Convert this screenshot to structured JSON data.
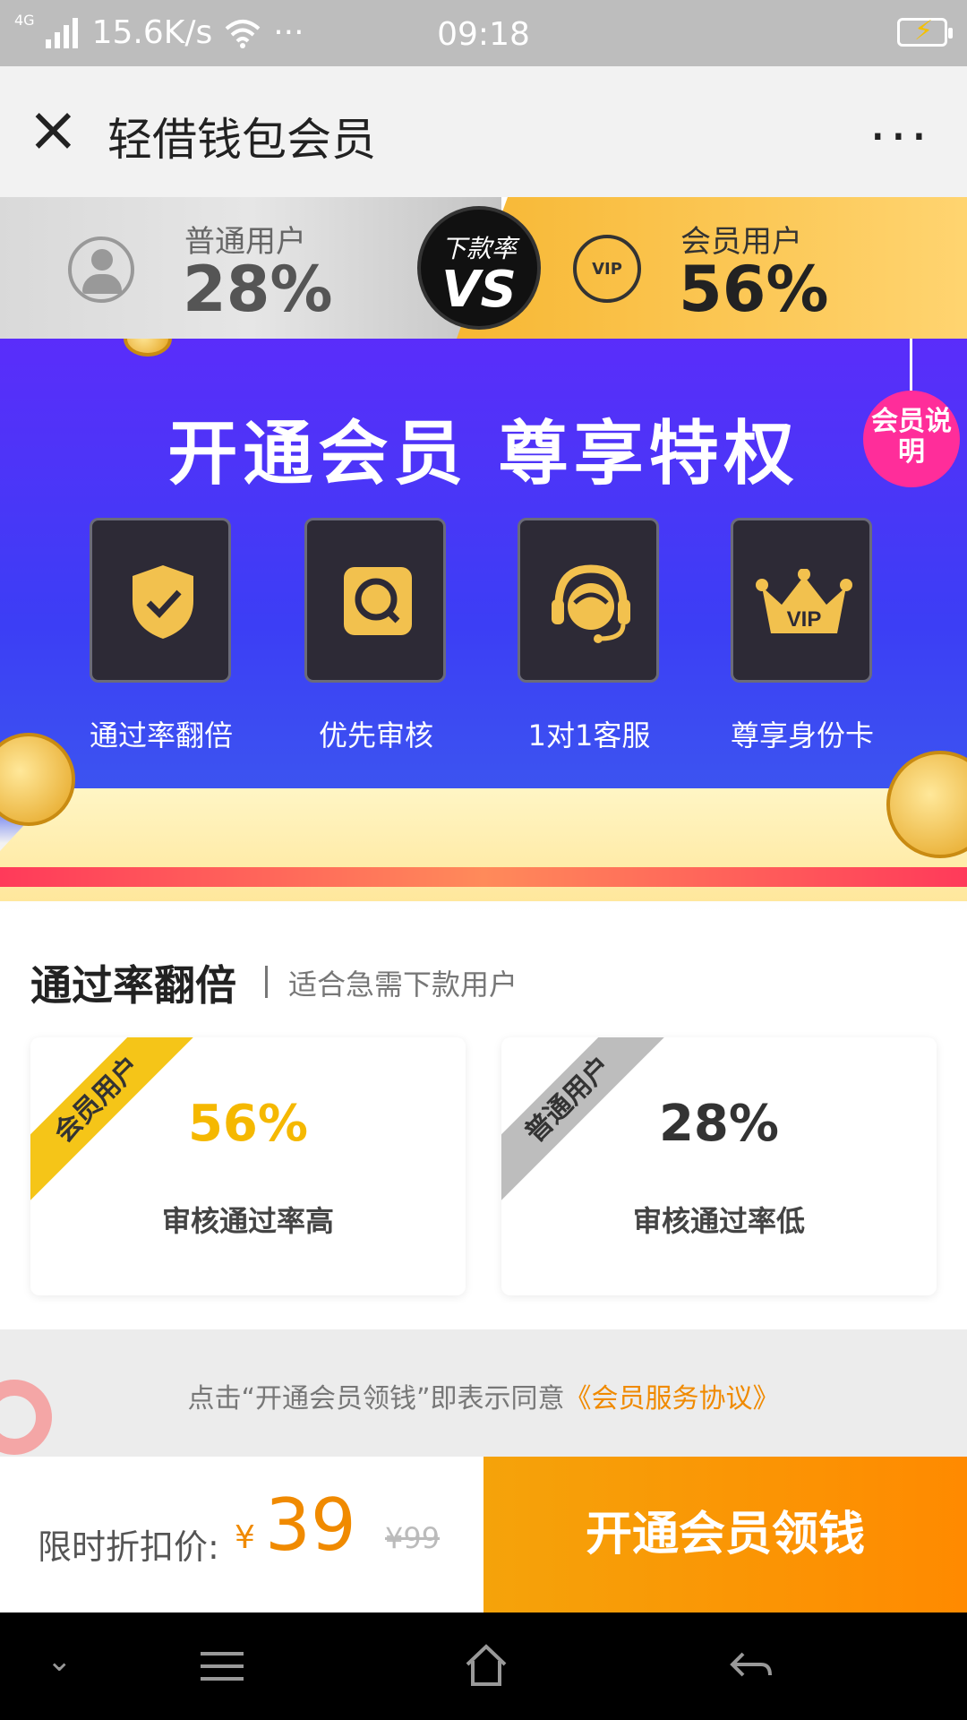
{
  "status_bar": {
    "network": "4G",
    "speed": "15.6K/s",
    "dots": "···",
    "time": "09:18"
  },
  "title_bar": {
    "title": "轻借钱包会员"
  },
  "compare": {
    "normal_label": "普通用户",
    "normal_value": "28%",
    "vs_top": "下款率",
    "vs_text": "VS",
    "vip_badge": "VIP",
    "member_label": "会员用户",
    "member_value": "56%"
  },
  "banner": {
    "headline": "开通会员  尊享特权",
    "explain_button": "会员说明",
    "features": [
      {
        "label": "通过率翻倍",
        "icon": "shield-check-icon"
      },
      {
        "label": "优先审核",
        "icon": "search-icon"
      },
      {
        "label": "1对1客服",
        "icon": "headset-icon"
      },
      {
        "label": "尊享身份卡",
        "icon": "vip-crown-icon"
      }
    ],
    "vip_text": "VIP"
  },
  "section": {
    "title": "通过率翻倍",
    "subtitle": "适合急需下款用户",
    "cards": [
      {
        "ribbon": "会员用户",
        "percent": "56%",
        "desc": "审核通过率高",
        "color": "#f5b800"
      },
      {
        "ribbon": "普通用户",
        "percent": "28%",
        "desc": "审核通过率低",
        "color": "#333333"
      }
    ]
  },
  "agreement": {
    "prefix": "点击“开通会员领钱”即表示同意",
    "link": "《会员服务协议》"
  },
  "purchase": {
    "label": "限时折扣价:",
    "currency": "¥",
    "price": "39",
    "original": "¥99",
    "button": "开通会员领钱"
  },
  "colors": {
    "accent": "#f5a30a",
    "banner": "#4a36f5",
    "explain": "#ff2d9a"
  }
}
